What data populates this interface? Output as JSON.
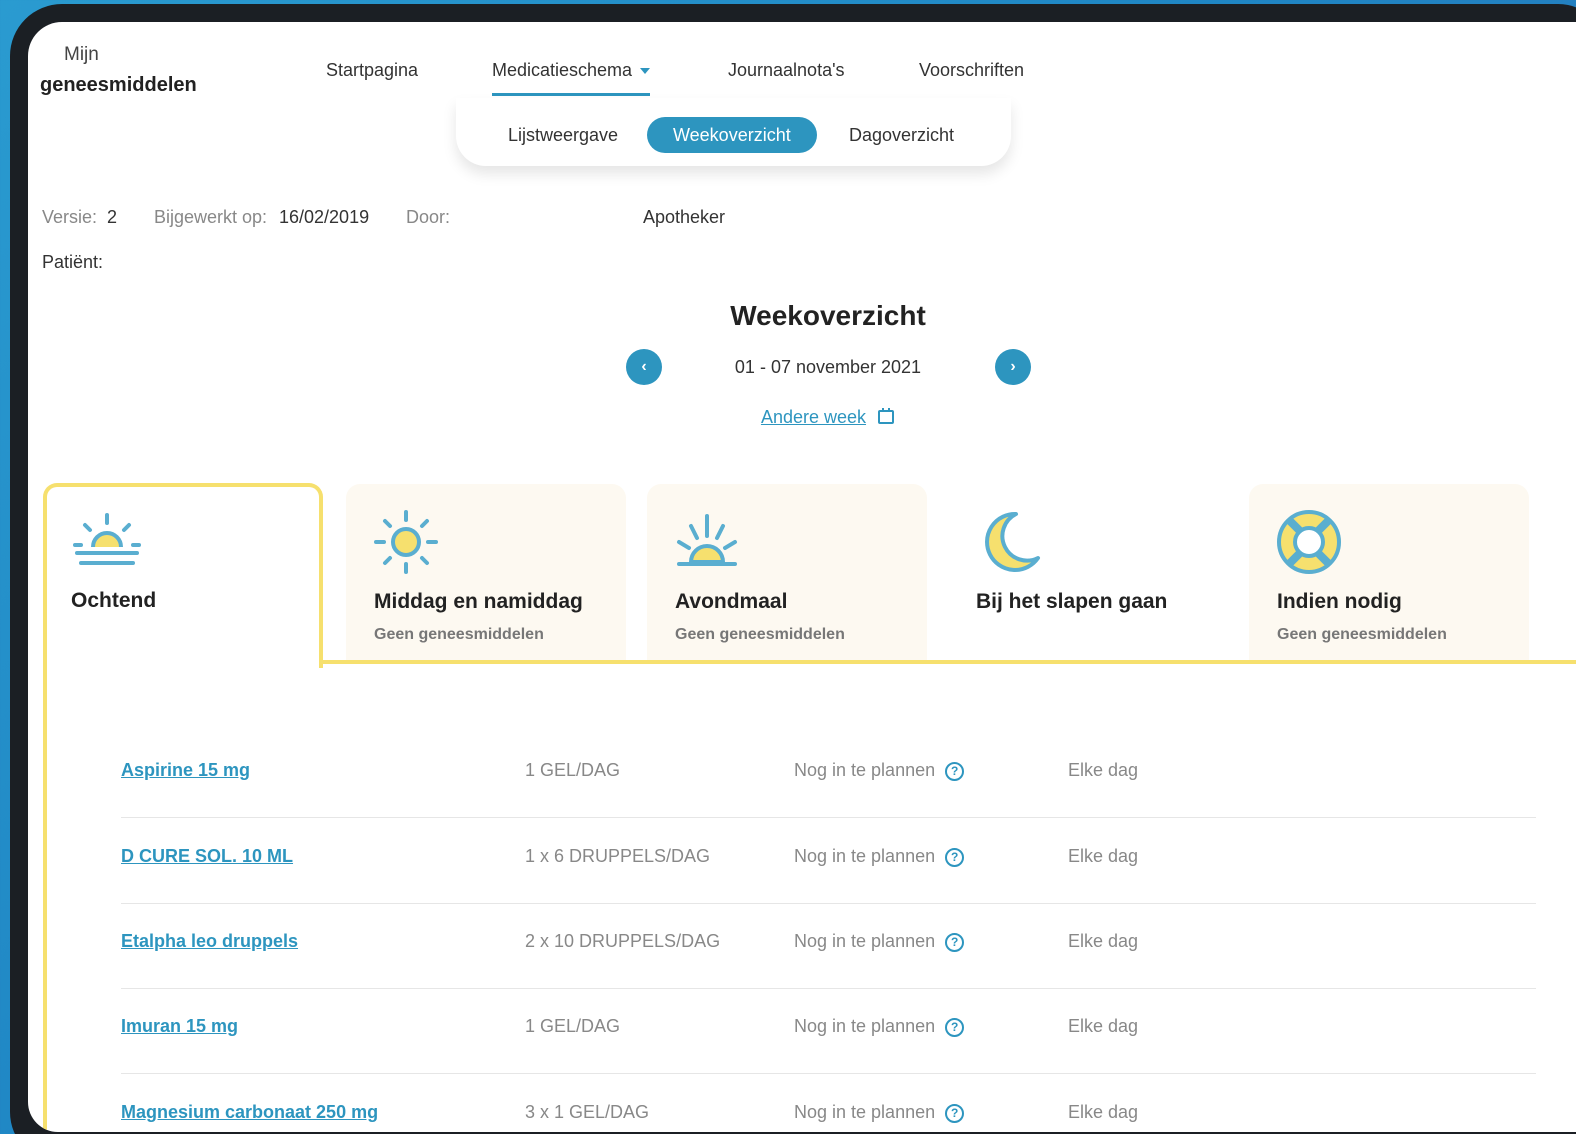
{
  "brand": {
    "line1": "Mijn",
    "line2": "geneesmiddelen"
  },
  "nav": {
    "home": "Startpagina",
    "schedule": "Medicatieschema",
    "journal": "Journaalnota's",
    "prescriptions": "Voorschriften"
  },
  "subnav": {
    "list": "Lijstweergave",
    "week": "Weekoverzicht",
    "day": "Dagoverzicht"
  },
  "meta": {
    "version_label": "Versie:",
    "version_value": "2",
    "updated_label": "Bijgewerkt op:",
    "updated_value": "16/02/2019",
    "by_label": "Door:",
    "by_value": "Apotheker",
    "patient_label": "Patiënt:"
  },
  "week": {
    "title": "Weekoverzicht",
    "range": "01 - 07 november 2021",
    "other_week": "Andere week",
    "prev_glyph": "‹",
    "next_glyph": "›"
  },
  "tabs": [
    {
      "title": "Ochtend",
      "subtitle": "",
      "icon": "sunrise-icon"
    },
    {
      "title": "Middag en namiddag",
      "subtitle": "Geen geneesmiddelen",
      "icon": "sun-icon"
    },
    {
      "title": "Avondmaal",
      "subtitle": "Geen geneesmiddelen",
      "icon": "sunset-icon"
    },
    {
      "title": "Bij het slapen gaan",
      "subtitle": "",
      "icon": "moon-icon"
    },
    {
      "title": "Indien nodig",
      "subtitle": "Geen geneesmiddelen",
      "icon": "lifebuoy-icon"
    }
  ],
  "medications": [
    {
      "name": "Aspirine 15 mg",
      "dose": "1 GEL/DAG",
      "plan": "Nog in te plannen",
      "help": "?",
      "freq": "Elke dag"
    },
    {
      "name": "D CURE SOL. 10 ML",
      "dose": "1 x 6 DRUPPELS/DAG",
      "plan": "Nog in te plannen",
      "help": "?",
      "freq": "Elke dag"
    },
    {
      "name": "Etalpha leo druppels",
      "dose": "2 x 10 DRUPPELS/DAG",
      "plan": "Nog in te plannen",
      "help": "?",
      "freq": "Elke dag"
    },
    {
      "name": "Imuran 15 mg",
      "dose": "1 GEL/DAG",
      "plan": "Nog in te plannen",
      "help": "?",
      "freq": "Elke dag"
    },
    {
      "name": "Magnesium carbonaat 250 mg",
      "dose": "3 x 1 GEL/DAG",
      "plan": "Nog in te plannen",
      "help": "?",
      "freq": "Elke dag"
    }
  ],
  "colors": {
    "accent": "#2d95bf",
    "highlight": "#f6e06e",
    "tab_bg": "#fdf9f1",
    "sun": "#f6e06e",
    "stroke": "#5aaed0"
  }
}
